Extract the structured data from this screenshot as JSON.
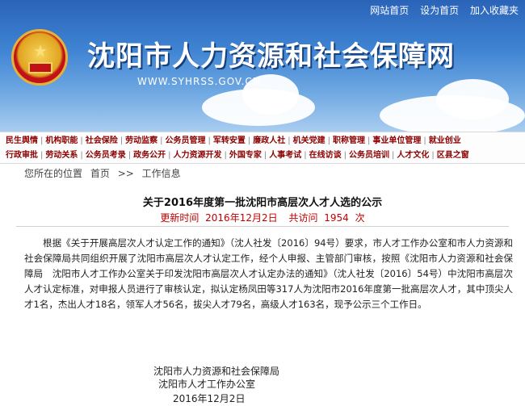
{
  "top_links": [
    "网站首页",
    "设为首页",
    "加入收藏夹"
  ],
  "site": {
    "title": "沈阳市人力资源和社会保障网",
    "url": "WWW.SYHRSS.GOV.CN"
  },
  "nav": {
    "row1": [
      "民生舆情",
      "机构职能",
      "社会保险",
      "劳动监察",
      "公务员管理",
      "军转安置",
      "廉政人社",
      "机关党建",
      "职称管理",
      "事业单位管理",
      "就业创业"
    ],
    "row2": [
      "行政审批",
      "劳动关系",
      "公务员考录",
      "政务公开",
      "人力资源开发",
      "外国专家",
      "人事考试",
      "在线访谈",
      "公务员培训",
      "人才文化",
      "区县之窗"
    ]
  },
  "breadcrumb": {
    "prefix": "您所在的位置",
    "home": "首页",
    "separator": ">>",
    "section": "工作信息"
  },
  "article": {
    "title": "关于2016年度第一批沈阳市高层次人才人选的公示",
    "updated_label": "更新时间",
    "updated_value": "2016年12月2日",
    "visits_label": "共访问",
    "visits_value": "1954",
    "visits_unit": "次",
    "body": "根据《关于开展高层次人才认定工作的通知》（沈人社发〔2016〕94号）要求，市人才工作办公室和市人力资源和社会保障局共同组织开展了沈阳市高层次人才认定工作，经个人申报、主管部门审核，按照《沈阳市人力资源和社会保障局　沈阳市人才工作办公室关于印发沈阳市高层次人才认定办法的通知》（沈人社发〔2016〕54号）中沈阳市高层次人才认定标准，对申报人员进行了审核认定，拟认定杨凤田等317人为沈阳市2016年度第一批高层次人才，其中顶尖人才1名，杰出人才18名，领军人才56名，拔尖人才79名，高级人才163名，现予公示三个工作日。",
    "signature": [
      "沈阳市人力资源和社会保障局",
      "沈阳市人才工作办公室",
      "2016年12月2日"
    ]
  },
  "colors": {
    "banner_top": "#2a63b8",
    "nav_text": "#8b0000",
    "meta_red": "#c00000"
  }
}
